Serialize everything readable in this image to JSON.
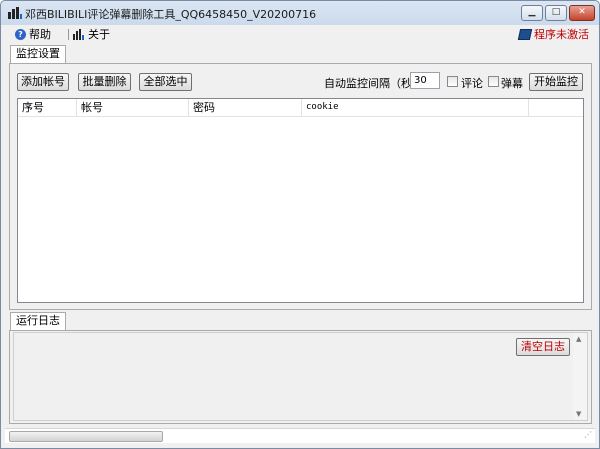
{
  "window": {
    "title": "邓西BILIBILI评论弹幕删除工具_QQ6458450_V20200716"
  },
  "menu": {
    "help_label": "帮助",
    "about_label": "关于",
    "activation_status": "程序未激活"
  },
  "tabs": {
    "monitor_tab": "监控设置",
    "log_tab": "运行日志"
  },
  "toolbar": {
    "add_account": "添加帐号",
    "batch_delete": "批量删除",
    "select_all": "全部选中",
    "interval_label": "自动监控间隔（秒）",
    "interval_value": "30",
    "comment_label": "评论",
    "danmaku_label": "弹幕",
    "start_monitor": "开始监控"
  },
  "table": {
    "columns": [
      "序号",
      "帐号",
      "密码",
      "cookie"
    ],
    "rows": []
  },
  "log": {
    "clear_button": "清空日志"
  },
  "colors": {
    "activation_text": "#c00000",
    "clear_button_text": "#c00000"
  }
}
